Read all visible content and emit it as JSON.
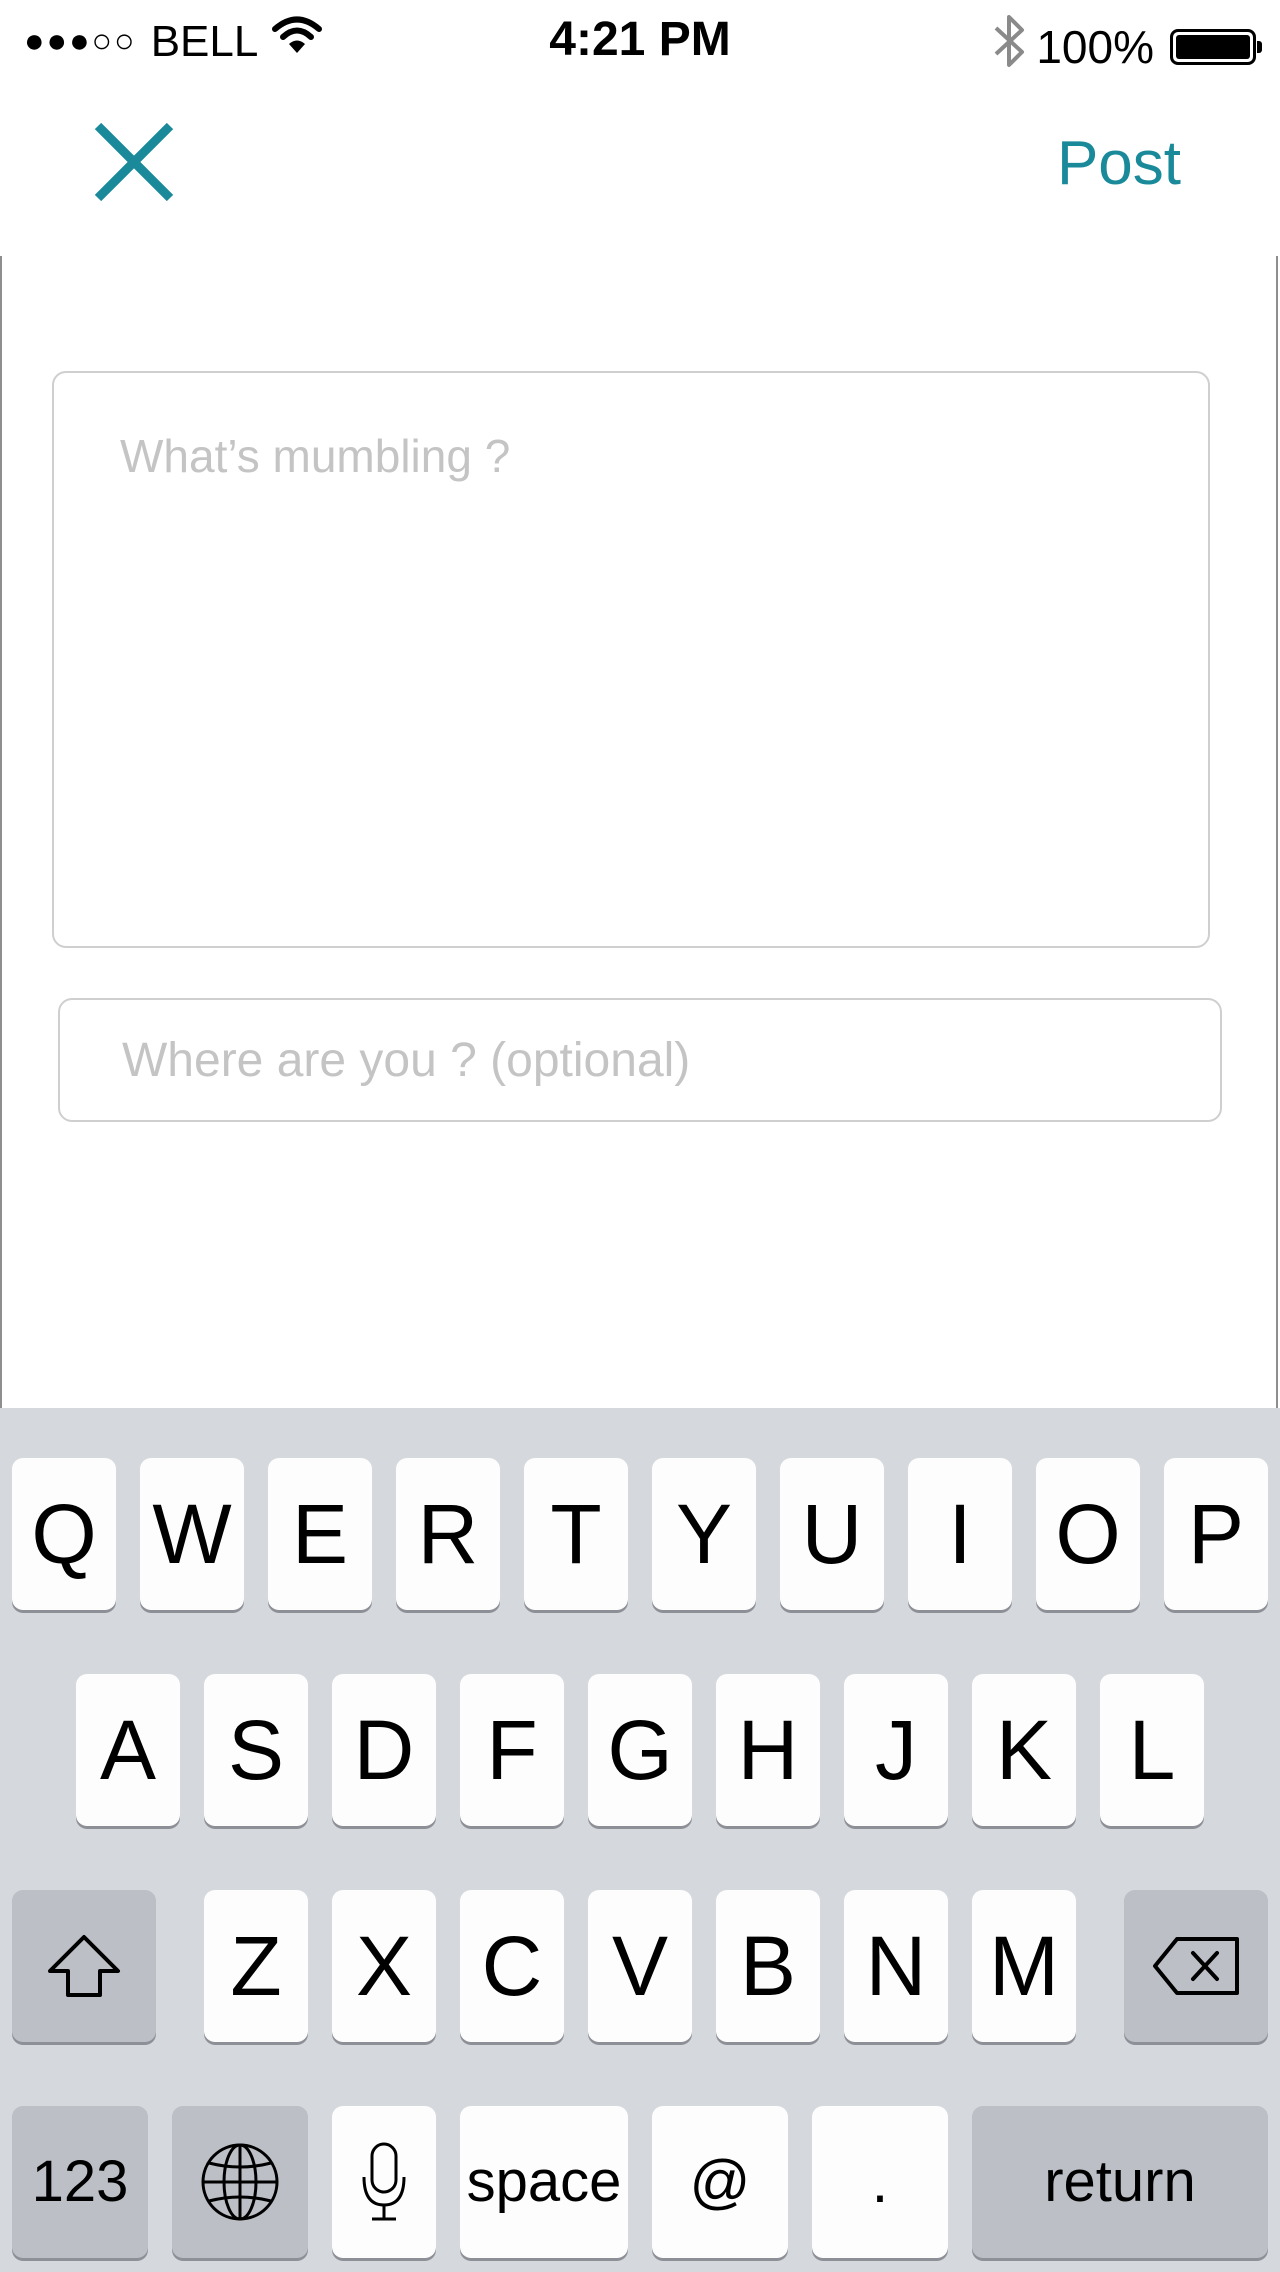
{
  "status_bar": {
    "signal_dots": "●●●○○",
    "carrier": "BELL",
    "time": "4:21 PM",
    "battery_percent": "100%",
    "battery_level": 1.0,
    "icons": [
      "wifi-icon",
      "bluetooth-icon",
      "battery-icon"
    ]
  },
  "nav": {
    "close_icon": "close-icon",
    "post_label": "Post"
  },
  "compose": {
    "message_placeholder": "What’s mumbling ?",
    "location_placeholder": "Where are you ? (optional)"
  },
  "keyboard": {
    "row1": [
      "Q",
      "W",
      "E",
      "R",
      "T",
      "Y",
      "U",
      "I",
      "O",
      "P"
    ],
    "row2": [
      "A",
      "S",
      "D",
      "F",
      "G",
      "H",
      "J",
      "K",
      "L"
    ],
    "row3": [
      "Z",
      "X",
      "C",
      "V",
      "B",
      "N",
      "M"
    ],
    "numbers_label": "123",
    "space_label": "space",
    "at_label": "@",
    "period_label": ".",
    "return_label": "return"
  },
  "colors": {
    "accent": "#1a8a9a",
    "keyboard_bg": "#d5d8dd",
    "placeholder": "#c4c4c4"
  }
}
